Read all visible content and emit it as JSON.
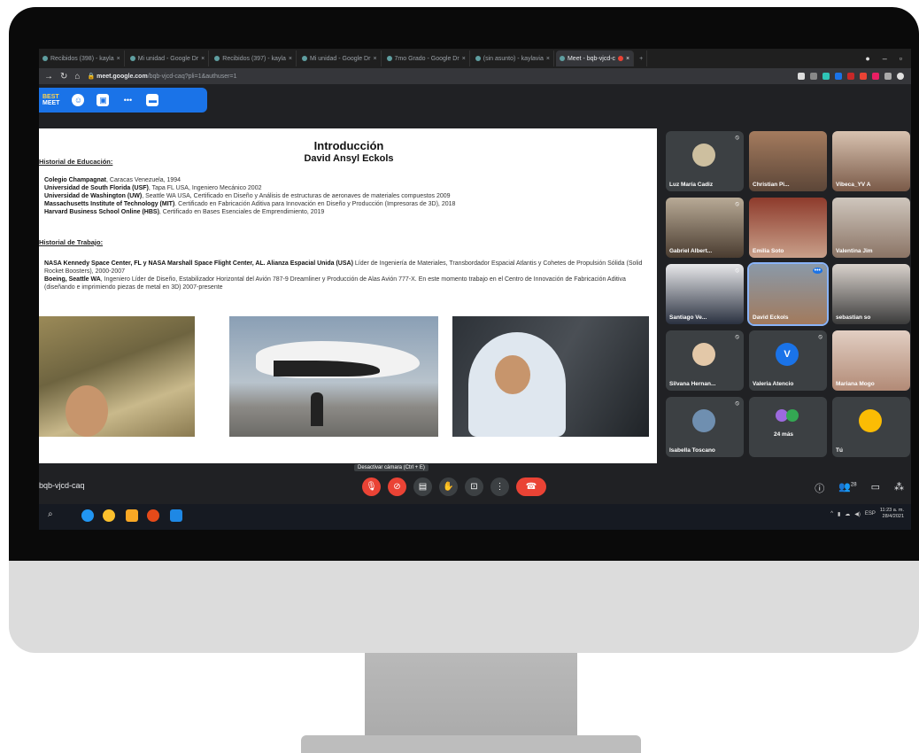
{
  "browser": {
    "tabs": [
      {
        "label": "Recibidos (398) - kayla"
      },
      {
        "label": "Mi unidad - Google Dr"
      },
      {
        "label": "Recibidos (397) - kayla"
      },
      {
        "label": "Mi unidad - Google Dr"
      },
      {
        "label": "7mo Grado - Google Dr"
      },
      {
        "label": "(sin asunto) - kaylavia"
      },
      {
        "label": "Meet - bqb-vjcd-c"
      }
    ],
    "url_host": "meet.google.com",
    "url_path": "/bqb-vjcd-caq?pli=1&authuser=1"
  },
  "extension": {
    "logo_line1": "BEST",
    "logo_line2": "MEET"
  },
  "slide": {
    "title": "Introducción",
    "subtitle": "David Ansyl Eckols",
    "education_heading": "Historial de Educación:",
    "education": [
      {
        "bold": "Colegio Champagnat",
        "text": ", Caracas Venezuela, 1994"
      },
      {
        "bold": "Universidad de South Florida (USF)",
        "text": ", Tapa FL USA, Ingeniero Mecánico 2002"
      },
      {
        "bold": "Universidad de Washington (UW)",
        "text": ", Seattle WA USA, Certificado en Diseño y Análisis de estructuras de aeronaves de materiales compuestos 2009"
      },
      {
        "bold": "Massachusetts Institute of Technology (MIT)",
        "text": ". Certificado en Fabricación Aditiva para Innovación en Diseño y Producción (Impresoras de 3D), 2018"
      },
      {
        "bold": "Harvard Business School Online (HBS)",
        "text": ", Certificado en Bases Esenciales de Emprendimiento, 2019"
      }
    ],
    "work_heading": "Historial de Trabajo:",
    "work": [
      {
        "bold": "NASA Kennedy Space Center, FL y NASA Marshall Space Flight Center, AL. Alianza Espacial Unida (USA)",
        "text": " Líder de Ingeniería de Materiales, Transbordador Espacial Atlantis y Cohetes de Propulsión Sólida (Solid Rocket Boosters), 2000-2007"
      },
      {
        "bold": "Boeing, Seattle WA",
        "text": ", Ingeniero Líder de Diseño, Estabilizador Horizontal del Avión 787-9 Dreamliner y Producción de Alas Avión 777-X. En este momento trabajo en el Centro de Innovación de Fabricación Aditiva (diseñando e imprimiendo piezas de metal en 3D) 2007-presente"
      }
    ]
  },
  "participants": [
    {
      "name": "Luz María Cadiz"
    },
    {
      "name": "Christian Pi..."
    },
    {
      "name": "Vibeca_YV A"
    },
    {
      "name": "Gabriel Albert..."
    },
    {
      "name": "Emilia Soto"
    },
    {
      "name": "Valentina Jim"
    },
    {
      "name": "Santiago Ve..."
    },
    {
      "name": "David Eckols"
    },
    {
      "name": "sebastian so"
    },
    {
      "name": "Silvana Hernan..."
    },
    {
      "name": "Valeria Atencio",
      "initial": "V"
    },
    {
      "name": "Mariana Mogo"
    },
    {
      "name": "Isabella Toscano"
    },
    {
      "name": "24 más"
    },
    {
      "name": "Tú"
    }
  ],
  "bottombar": {
    "meeting_code": "bqb-vjcd-caq",
    "tooltip": "Desactivar cámara (Ctrl + E)",
    "participant_count": "28"
  },
  "taskbar": {
    "language": "ESP",
    "time": "11:23 a. m.",
    "date": "28/4/2021"
  },
  "colors": {
    "meet_blue": "#1a73e8",
    "meet_red": "#ea4335"
  }
}
